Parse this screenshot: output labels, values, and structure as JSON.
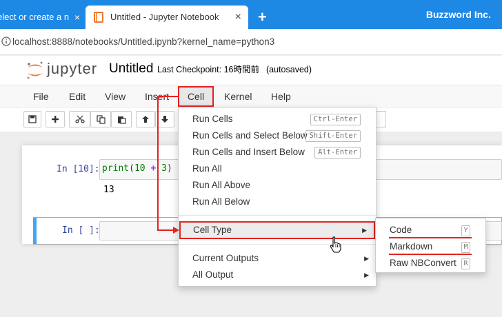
{
  "browser": {
    "inactive_tab_label": "elect or create a n",
    "active_tab_title": "Untitled - Jupyter Notebook",
    "new_tab_symbol": "+",
    "close_symbol": "×",
    "brand": "Buzzword Inc.",
    "url": "localhost:8888/notebooks/Untitled.ipynb?kernel_name=python3"
  },
  "jupyter": {
    "logo_text": "jupyter",
    "notebook_title": "Untitled",
    "checkpoint_label": "Last Checkpoint: 16時間前",
    "autosaved": "(autosaved)"
  },
  "menubar": {
    "items": [
      "File",
      "Edit",
      "View",
      "Insert",
      "Cell",
      "Kernel",
      "Help"
    ]
  },
  "cells": {
    "cell1_prompt": "In [10]:",
    "cell1_code_print": "print",
    "cell1_code_open": "(",
    "cell1_code_a": "10",
    "cell1_code_op": " + ",
    "cell1_code_b": "3",
    "cell1_code_close": ")",
    "cell1_output": "13",
    "cell2_prompt": "In [ ]:"
  },
  "cell_menu": {
    "run_cells": "Run Cells",
    "run_cells_key": "Ctrl-Enter",
    "run_select_below": "Run Cells and Select Below",
    "run_select_below_key": "Shift-Enter",
    "run_insert_below": "Run Cells and Insert Below",
    "run_insert_below_key": "Alt-Enter",
    "run_all": "Run All",
    "run_all_above": "Run All Above",
    "run_all_below": "Run All Below",
    "cell_type": "Cell Type",
    "current_outputs": "Current Outputs",
    "all_output": "All Output"
  },
  "cell_type_submenu": {
    "code": "Code",
    "code_key": "Y",
    "markdown": "Markdown",
    "markdown_key": "M",
    "raw": "Raw NBConvert",
    "raw_key": "R"
  },
  "colors": {
    "browser_blue": "#1e88e5",
    "highlight_red": "#e12323",
    "jupyter_orange": "#f37726",
    "selected_cell_blue": "#42a5f5"
  },
  "icons": {
    "save": "floppy-icon",
    "insert": "plus-icon",
    "cut": "scissors-icon",
    "copy": "copy-icon",
    "paste": "paste-icon",
    "move_up": "arrow-up-icon",
    "move_down": "arrow-down-icon"
  }
}
